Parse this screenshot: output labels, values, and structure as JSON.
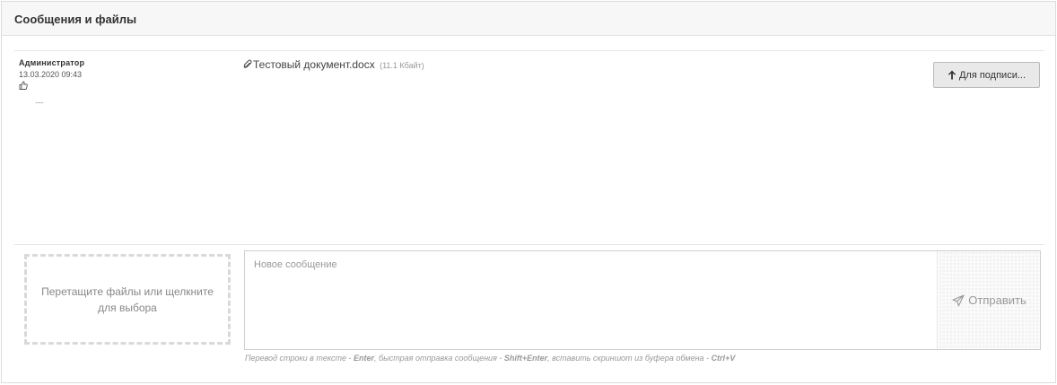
{
  "panel": {
    "title": "Сообщения и файлы"
  },
  "message": {
    "author": "Администратор",
    "date": "13.03.2020 09:43",
    "dots": "......",
    "file_name": "Тестовый документ.docx",
    "file_size": "(11.1 Кбайт)",
    "sign_button_label": "Для подписи..."
  },
  "composer": {
    "dropzone_text": "Перетащите файлы или щелкните для выбора",
    "placeholder": "Новое сообщение",
    "send_label": "Отправить",
    "hint": {
      "p1": "Перевод строки в тексте - ",
      "k1": "Enter",
      "p2": ", быстрая отправка сообщения - ",
      "k2": "Shift+Enter",
      "p3": ", вставить скриншот из буфера обмена - ",
      "k3": "Ctrl+V"
    }
  },
  "icons": {
    "like": "thumbs-up-icon",
    "attachment": "paperclip-icon",
    "sign": "arrow-up-icon",
    "send": "paper-plane-icon"
  }
}
